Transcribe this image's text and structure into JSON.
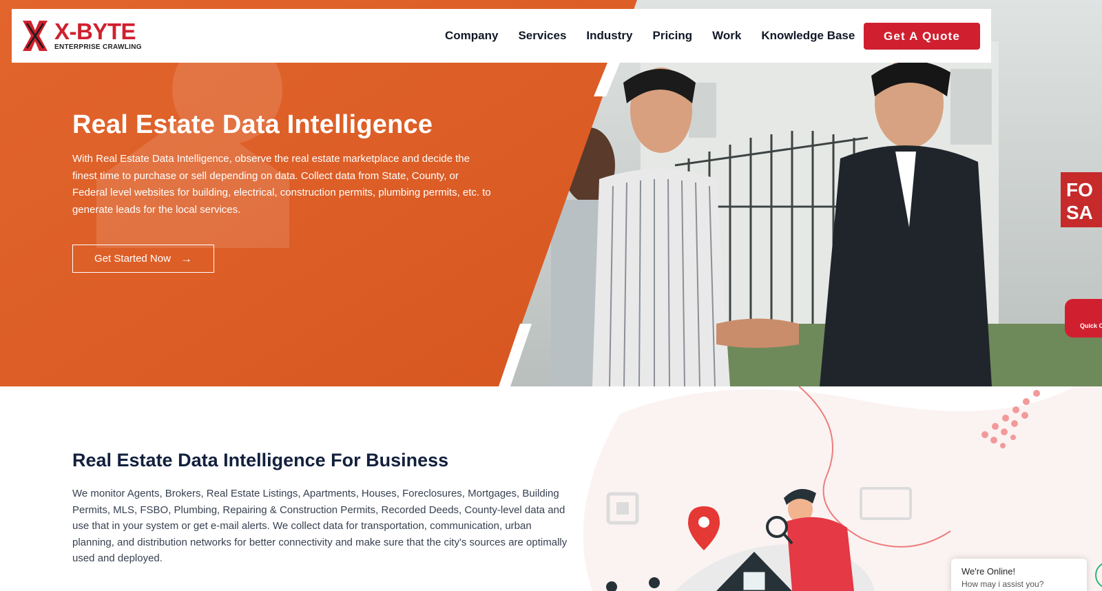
{
  "brand": {
    "name": "X-BYTE",
    "tagline": "ENTERPRISE CRAWLING",
    "accent_color": "#d0202f",
    "hero_color": "#e8612a"
  },
  "nav": {
    "items": [
      {
        "label": "Company"
      },
      {
        "label": "Services"
      },
      {
        "label": "Industry"
      },
      {
        "label": "Pricing"
      },
      {
        "label": "Work"
      },
      {
        "label": "Knowledge Base"
      }
    ],
    "cta_label": "Get A Quote"
  },
  "hero": {
    "title": "Real Estate Data Intelligence",
    "description": "With Real Estate Data Intelligence, observe the real estate marketplace and decide the finest time to purchase or sell depending on data. Collect data from State, County, or Federal level websites for building, electrical, construction permits, plumbing permits, etc. to generate leads for the local services.",
    "cta_label": "Get Started Now",
    "cta_icon": "arrow-right-icon",
    "sign_text": "FOR SALE",
    "quick_tab_label": "Quick C"
  },
  "section2": {
    "title": "Real Estate Data Intelligence For Business",
    "description": "We monitor Agents, Brokers, Real Estate Listings, Apartments, Houses, Foreclosures, Mortgages, Building Permits, MLS, FSBO, Plumbing, Repairing & Construction Permits, Recorded Deeds, County-level data and use that in your system or get e-mail alerts. We collect data for transportation, communication, urban planning, and distribution networks for better connectivity and make sure that the city's sources are optimally used and deployed."
  },
  "chat": {
    "title": "We're Online!",
    "subtitle": "How may i assist you?"
  }
}
